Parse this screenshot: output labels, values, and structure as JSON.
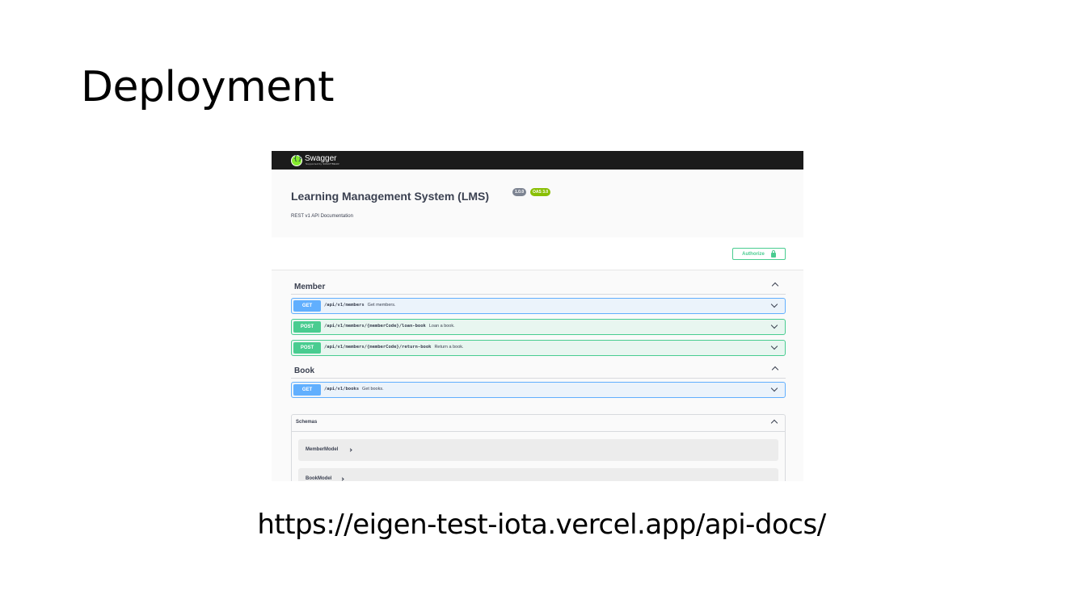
{
  "slide": {
    "title": "Deployment",
    "url": "https://eigen-test-iota.vercel.app/api-docs/"
  },
  "swagger": {
    "logo_text": "Swagger",
    "logo_sub": "Supported by SMARTBEAR",
    "api_title": "Learning Management System (LMS)",
    "version_badge": "1.0.0",
    "oas_badge": "OAS 3.0",
    "description": "REST v1 API Documentation",
    "authorize_label": "Authorize",
    "tags": [
      {
        "name": "Member",
        "operations": [
          {
            "method": "GET",
            "path": "/api/v1/members",
            "summary": "Get members."
          },
          {
            "method": "POST",
            "path": "/api/v1/members/{memberCode}/loan-book",
            "summary": "Loan a book."
          },
          {
            "method": "POST",
            "path": "/api/v1/members/{memberCode}/return-book",
            "summary": "Return a book."
          }
        ]
      },
      {
        "name": "Book",
        "operations": [
          {
            "method": "GET",
            "path": "/api/v1/books",
            "summary": "Get books."
          }
        ]
      }
    ],
    "schemas": {
      "title": "Schemas",
      "models": [
        "MemberModel",
        "BookModel"
      ]
    },
    "colors": {
      "topbar": "#1b1b1b",
      "get": "#61affe",
      "post": "#49cc90",
      "version_badge": "#7d8492",
      "oas_badge": "#89bf04"
    }
  }
}
